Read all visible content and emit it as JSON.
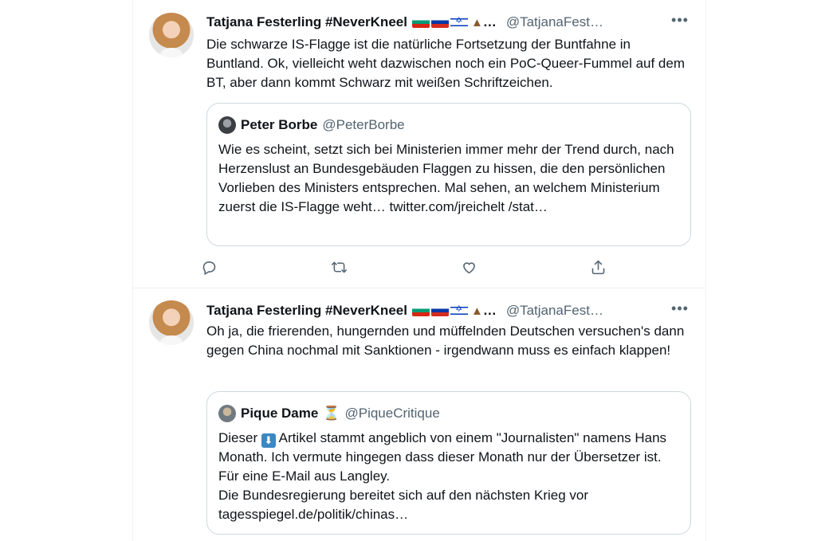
{
  "tweets": [
    {
      "author": {
        "name": "Tatjana Festerling #NeverKneel",
        "handle": "@TatjanaFest…",
        "truncation": "…"
      },
      "text": "Die schwarze IS-Flagge ist die natürliche Fortsetzung der Buntfahne in Buntland. Ok, vielleicht weht dazwischen noch ein PoC-Queer-Fummel auf dem BT, aber dann kommt Schwarz mit weißen Schriftzeichen.",
      "quoted": {
        "name": "Peter Borbe",
        "handle": "@PeterBorbe",
        "text": "Wie es scheint, setzt sich bei Ministerien immer mehr der Trend durch, nach Herzenslust an Bundesgebäuden Flaggen zu hissen, die den persönlichen Vorlieben des Ministers entsprechen. Mal sehen, an welchem Ministerium zuerst die IS-Flagge weht… twitter.com/jreichelt /stat…"
      },
      "more_label": "•••"
    },
    {
      "author": {
        "name": "Tatjana Festerling #NeverKneel",
        "handle": "@TatjanaFest…",
        "truncation": "…"
      },
      "text": "Oh ja, die frierenden, hungernden und müffelnden Deutschen versuchen's dann gegen China nochmal mit Sanktionen - irgendwann muss es einfach klappen!",
      "quoted": {
        "name": "Pique Dame",
        "handle": "@PiqueCritique",
        "name_emoji": "⏳",
        "text_before_emoji": "Dieser ",
        "text_emoji": "⬇",
        "text_after_emoji": " Artikel stammt angeblich von einem \"Journalisten\" namens Hans Monath. Ich vermute hingegen dass dieser Monath nur der Übersetzer ist. Für eine E-Mail aus Langley.",
        "text_line2": "Die Bundesregierung bereitet sich auf den nächsten Krieg vor",
        "text_line3": "tagesspiegel.de/politik/chinas…"
      },
      "more_label": "•••"
    }
  ],
  "icons": [
    "reply-icon",
    "retweet-icon",
    "like-icon",
    "share-icon",
    "more-icon"
  ]
}
